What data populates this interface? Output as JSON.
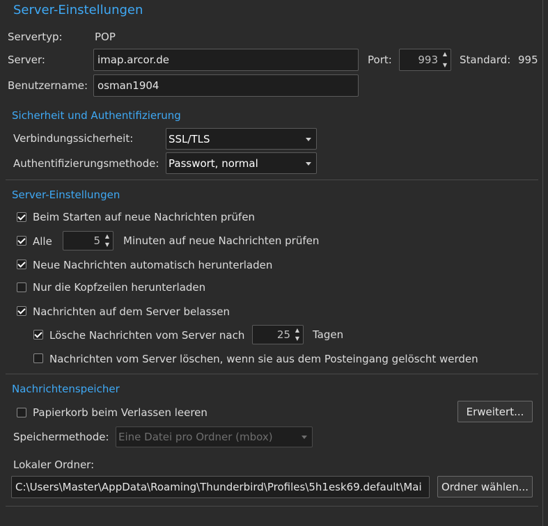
{
  "title": "Server-Einstellungen",
  "server": {
    "type_label": "Servertyp:",
    "type_value": "POP",
    "server_label": "Server:",
    "server_value": "imap.arcor.de",
    "port_label": "Port:",
    "port_value": "993",
    "default_label": "Standard:",
    "default_value": "995",
    "username_label": "Benutzername:",
    "username_value": "osman1904"
  },
  "security": {
    "title": "Sicherheit und Authentifizierung",
    "connection_label": "Verbindungssicherheit:",
    "connection_value": "SSL/TLS",
    "auth_label": "Authentifizierungsmethode:",
    "auth_value": "Passwort, normal"
  },
  "settings": {
    "title": "Server-Einstellungen",
    "check_on_start": "Beim Starten auf neue Nachrichten prüfen",
    "check_every_prefix": "Alle",
    "check_every_value": "5",
    "check_every_suffix": "Minuten auf neue Nachrichten prüfen",
    "auto_download": "Neue Nachrichten automatisch herunterladen",
    "headers_only": "Nur die Kopfzeilen herunterladen",
    "leave_on_server": "Nachrichten auf dem Server belassen",
    "delete_after_prefix": "Lösche Nachrichten vom Server nach",
    "delete_after_value": "25",
    "delete_after_suffix": "Tagen",
    "delete_when_removed": "Nachrichten vom Server löschen, wenn sie aus dem Posteingang gelöscht werden"
  },
  "storage": {
    "title": "Nachrichtenspeicher",
    "empty_trash": "Papierkorb beim Verlassen leeren",
    "advanced_button": "Erweitert...",
    "method_label": "Speichermethode:",
    "method_value": "Eine Datei pro Ordner (mbox)",
    "local_folder_label": "Lokaler Ordner:",
    "local_folder_value": "C:\\Users\\Master\\AppData\\Roaming\\Thunderbird\\Profiles\\5h1esk69.default\\Mai",
    "choose_folder_button": "Ordner wählen..."
  }
}
